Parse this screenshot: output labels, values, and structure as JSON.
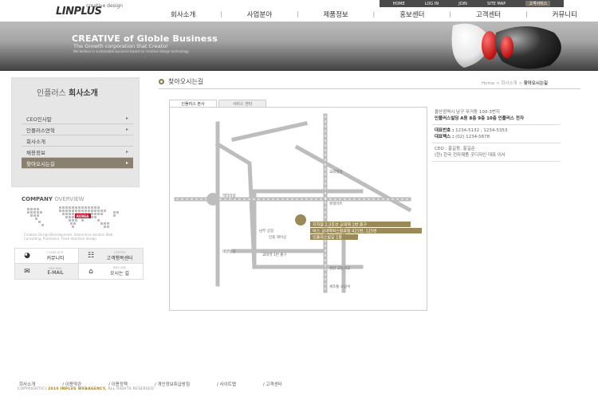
{
  "header": {
    "logo_text": "LINPLUS",
    "logo_sub": "creative design",
    "topbar": [
      "HOME",
      "LOG IN",
      "JOIN",
      "SITE MAP",
      "고객서비스"
    ],
    "gnav": [
      "회사소개",
      "사업분야",
      "제품정보",
      "홍보센터",
      "고객센터",
      "커뮤니티"
    ],
    "banner_title": "CREATIVE of Globle Business",
    "banner_sub": "The Growth corporation that Creator",
    "banner_small": "We believe in sustainable business based on creative design technology"
  },
  "sidebar": {
    "title_light": "인플러스",
    "title_bold": "회사소개",
    "items": [
      {
        "label": "CEO인사말",
        "arrow": "▸"
      },
      {
        "label": "인플러스연혁",
        "arrow": "▸"
      },
      {
        "label": "회사소개",
        "arrow": ""
      },
      {
        "label": "채용정보",
        "arrow": "▸"
      },
      {
        "label": "찾아오시는길",
        "arrow": "▸"
      }
    ],
    "company_title": "COMPANY",
    "company_title2": "OVERVIEW",
    "korea_label": "KOREA",
    "company_desc": "Creative Design/Development, Interactive solution Web Consulting, Promotion, Flash Interface design",
    "quick": [
      {
        "small": "CLEAR SITE",
        "label": "커뮤니티",
        "icon": "◕"
      },
      {
        "small": "CENTER",
        "label": "고객행복센터",
        "icon": "☷"
      },
      {
        "small": "MEN MAIL",
        "label": "E-MAIL",
        "icon": "✉"
      },
      {
        "small": "WAY LINE",
        "label": "오시는 길",
        "icon": "⌂"
      }
    ]
  },
  "content": {
    "title": "찾아오시는길",
    "breadcrumb": [
      "Home",
      "회사소개",
      "찾아오시는길"
    ],
    "tabs": [
      "인플러스 본사",
      "서비스 센터"
    ],
    "map_labels": {
      "church": "교회빌딩",
      "station": "역터미널",
      "cafe": "롯데마트",
      "market": "남부 상업",
      "bank": "인플 레이상",
      "apt": "대영빌딩",
      "metro_exit": "교대역 1번 출구",
      "school": "성산 고등학교",
      "hospital": "세조통 소방서"
    },
    "directions": [
      "지하철 2,3호선 교대역 1번 출구",
      "버스 교대역버스정류장 421번, 125번",
      "인플러스빌딩 1층"
    ],
    "info": {
      "address1": "울산광역시 남구 무거동 100-3번지",
      "address2": "인플러스빌딩 A동 8층 9층 10층 인플러스 전자",
      "tel_label": "대표번호 :",
      "tel": "1234-5132 , 1234-5353",
      "fax_label": "대표팩스 :",
      "fax": "(02) 1234-5878",
      "ceo_label": "CEO :",
      "ceo": "홍길동, 홍길순",
      "ceo_desc": "(현) 한국 전자제품 굿디자인 대표 이사"
    }
  },
  "footer": {
    "links": [
      "회사소개",
      "/ 이용약관",
      "/ 이용정책",
      "/ 개인정보취급방침",
      "/ 사이트맵",
      "/ 고객센터"
    ],
    "copyright_pre": "COPYRIGHT(C) ",
    "copyright_brand": "2010 INPLUS WEBAGENCY,",
    "copyright_post": " ALL RIGHTS RESERVED"
  },
  "colors": {
    "accent": "#8a8070",
    "banner_dark": "#3f3f3f",
    "direction_bar": "#9a8a5a"
  }
}
